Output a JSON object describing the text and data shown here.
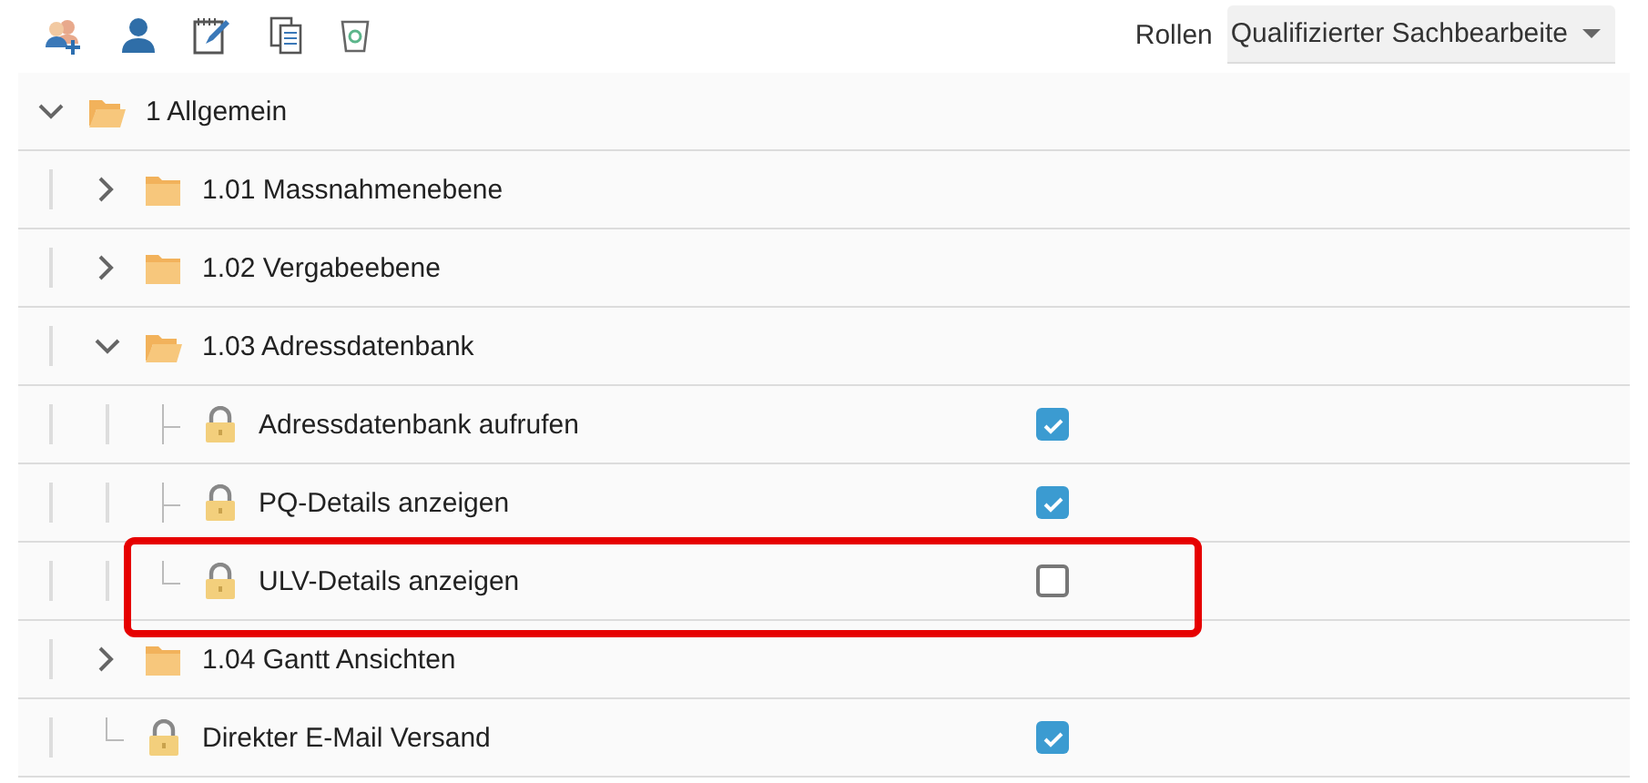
{
  "toolbar": {
    "roles_label": "Rollen",
    "role_select": {
      "value": "Qualifizierter Sachbearbeite"
    }
  },
  "tree": [
    {
      "kind": "folder",
      "label": "1 Allgemein",
      "expanded": true,
      "children": [
        {
          "kind": "folder",
          "label": "1.01 Massnahmenebene",
          "expanded": false
        },
        {
          "kind": "folder",
          "label": "1.02 Vergabeebene",
          "expanded": false
        },
        {
          "kind": "folder",
          "label": "1.03 Adressdatenbank",
          "expanded": true,
          "children": [
            {
              "kind": "permission",
              "label": "Adressdatenbank aufrufen",
              "checked": true,
              "highlighted": false
            },
            {
              "kind": "permission",
              "label": "PQ-Details anzeigen",
              "checked": true,
              "highlighted": false
            },
            {
              "kind": "permission",
              "label": "ULV-Details anzeigen",
              "checked": false,
              "highlighted": true
            }
          ]
        },
        {
          "kind": "folder",
          "label": "1.04 Gantt Ansichten",
          "expanded": false
        },
        {
          "kind": "permission",
          "label": "Direkter E-Mail Versand",
          "checked": true,
          "highlighted": false
        }
      ]
    }
  ]
}
